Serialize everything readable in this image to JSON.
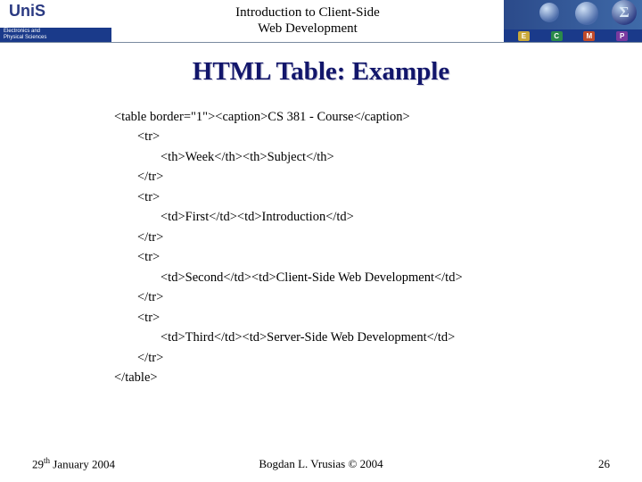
{
  "header": {
    "logo_text": "UniS",
    "dept_line1": "Electronics and",
    "dept_line2": "Physical Sciences",
    "title_line1": "Introduction to Client-Side",
    "title_line2": "Web Development",
    "sigma": "Σ",
    "badges": {
      "e": "E",
      "c": "C",
      "m": "M",
      "p": "P"
    }
  },
  "slide": {
    "title": "HTML Table: Example",
    "code_lines": [
      {
        "indent": 0,
        "text": "<table border=\"1\"><caption>CS 381 - Course</caption>"
      },
      {
        "indent": 1,
        "text": "<tr>"
      },
      {
        "indent": 2,
        "text": "<th>Week</th><th>Subject</th>"
      },
      {
        "indent": 1,
        "text": "</tr>"
      },
      {
        "indent": 1,
        "text": "<tr>"
      },
      {
        "indent": 2,
        "text": "<td>First</td><td>Introduction</td>"
      },
      {
        "indent": 1,
        "text": "</tr>"
      },
      {
        "indent": 1,
        "text": "<tr>"
      },
      {
        "indent": 2,
        "text": "<td>Second</td><td>Client-Side Web Development</td>"
      },
      {
        "indent": 1,
        "text": "</tr>"
      },
      {
        "indent": 1,
        "text": "<tr>"
      },
      {
        "indent": 2,
        "text": "<td>Third</td><td>Server-Side Web Development</td>"
      },
      {
        "indent": 1,
        "text": "</tr>"
      },
      {
        "indent": 0,
        "text": "</table>"
      }
    ]
  },
  "footer": {
    "date_day": "29",
    "date_suffix": "th",
    "date_rest": " January 2004",
    "copyright": "Bogdan L. Vrusias © 2004",
    "page": "26"
  }
}
